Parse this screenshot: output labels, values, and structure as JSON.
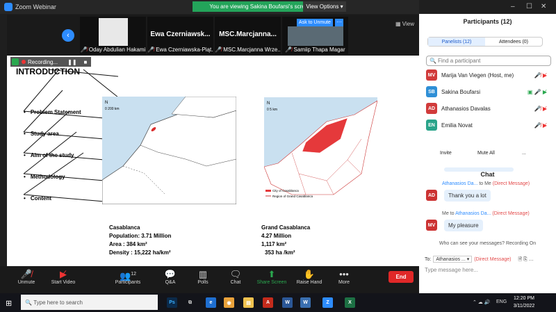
{
  "window": {
    "title": "Zoom Webinar",
    "banner": "You are viewing Sakina Boufarsi's screen",
    "view_options": "View Options ▾",
    "minimize": "–",
    "maximize": "☐",
    "close": "✕"
  },
  "strip": {
    "back_icon": "chevron-left-icon",
    "view_label": "View",
    "tiles": [
      {
        "name": "Oday Abdulian Hakami"
      },
      {
        "big": "Ewa Czerniawsk...",
        "name": "Ewa Czerniawska-Piąt..."
      },
      {
        "big": "MSC.Marcjanna...",
        "name": "MSC.Marcjanna Wrze..."
      },
      {
        "name": "Samiip Thapa Magar"
      }
    ],
    "ask_unmute": "Ask to Unmute",
    "more_dots": "···"
  },
  "recording": {
    "label": "Recording...",
    "pause": "❚❚",
    "stop": "■"
  },
  "slide": {
    "heading": "INTRODUCTION",
    "bullets": [
      "Problem Statement",
      "Study area",
      "Aim of the study",
      "Methodology",
      "Content"
    ],
    "map1": {
      "north": "N",
      "scale": "0     200 km"
    },
    "map2": {
      "north": "N",
      "scale": "0    5 km",
      "legend": [
        "City of Casablanca",
        "Region of Grand Casablanca"
      ]
    },
    "left_stats": [
      "Casablanca",
      "Population:  3.71 Million",
      "Area : 384 km²",
      "Density : 15,222 ha/km²"
    ],
    "right_stats": [
      "Grand Casablanca",
      "4.27 Million",
      "1,117  km²",
      "353 ha /km²"
    ]
  },
  "controls": {
    "mute": "Unmute",
    "video": "Start Video",
    "participants": "Participants",
    "participants_count": "12",
    "qa": "Q&A",
    "polls": "Polls",
    "chat": "Chat",
    "share": "Share Screen",
    "raise": "Raise Hand",
    "more": "More",
    "end": "End"
  },
  "panel": {
    "title": "Participants (12)",
    "tab_panelists": "Panelists (12)",
    "tab_attendees": "Attendees (0)",
    "find_placeholder": "Find a participant",
    "people": [
      {
        "initials": "MV",
        "name": "Marija Van Viegen (Host, me)",
        "color": "#d13b3b"
      },
      {
        "initials": "SB",
        "name": "Sakina Boufarsi",
        "color": "#2f8fd6"
      },
      {
        "initials": "AD",
        "name": "Athanasios Davalas",
        "color": "#d13b3b"
      },
      {
        "initials": "EN",
        "name": "Emilia Novat",
        "color": "#2aa48a"
      }
    ],
    "invite": "Invite",
    "mute_all": "Mute All",
    "more": "...",
    "chat_title": "Chat",
    "msg1_from": "Athanasios Da...",
    "msg1_to": " to Me",
    "msg1_dm": "(Direct Message)",
    "msg1_text": "Thank you a lot",
    "msg1_av": "AD",
    "msg2_me": "Me to ",
    "msg2_to": "Athanasios Da...",
    "msg2_dm": "(Direct Message)",
    "msg2_text": "My pleasure",
    "msg2_av": "MV",
    "who_can_see": "Who can see your messages? Recording On",
    "to_label": "To:",
    "to_value": "Athanasios ... ▾",
    "to_dm": "(Direct Message)",
    "type_placeholder": "Type message here..."
  },
  "taskbar": {
    "search": "Type here to search",
    "lang": "ENG",
    "time": "12:20 PM",
    "date": "3/11/2022"
  }
}
